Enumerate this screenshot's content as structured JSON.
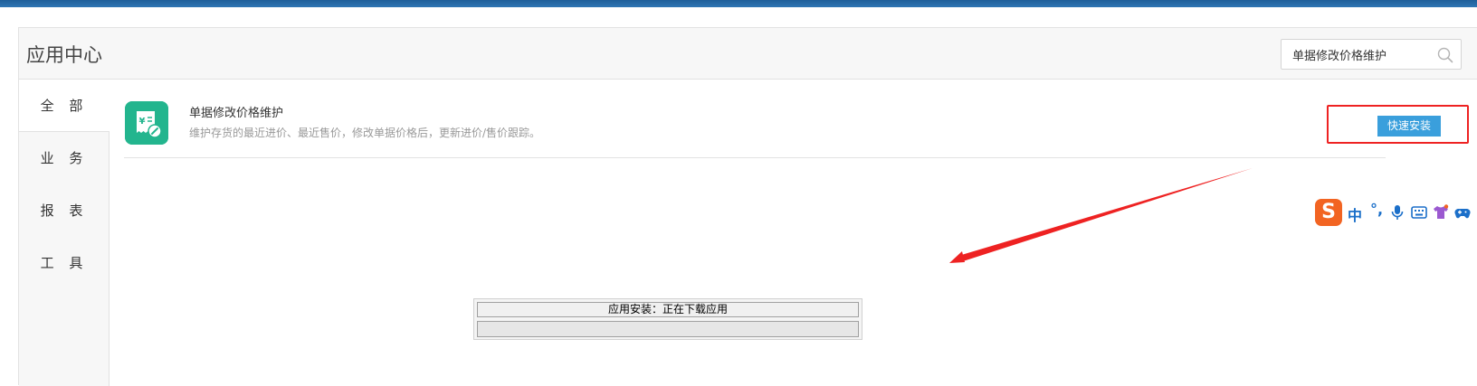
{
  "header": {
    "title": "应用中心",
    "search_value": "单据修改价格维护",
    "search_icon": "search-icon"
  },
  "sidebar": {
    "items": [
      {
        "label": "全 部",
        "active": true
      },
      {
        "label": "业 务",
        "active": false
      },
      {
        "label": "报 表",
        "active": false
      },
      {
        "label": "工 具",
        "active": false
      }
    ]
  },
  "app": {
    "name": "单据修改价格维护",
    "description": "维护存货的最近进价、最近售价，修改单据价格后，更新进价/售价跟踪。",
    "icon": "receipt-yen-edit-icon",
    "icon_color": "#23b58e",
    "install_label": "快速安装",
    "install_color": "#3a9fdc"
  },
  "annotation": {
    "highlight_color": "#ee2222",
    "arrow_color": "#ee2222"
  },
  "ime_toolbar": {
    "logo": "S",
    "mode": "中",
    "punct": "°,",
    "icons": [
      "microphone-icon",
      "keyboard-icon",
      "skin-shirt-icon",
      "gamepad-icon"
    ],
    "logo_color": "#f26422"
  },
  "progress_dialog": {
    "title": "应用安装：正在下载应用",
    "progress": 0
  }
}
